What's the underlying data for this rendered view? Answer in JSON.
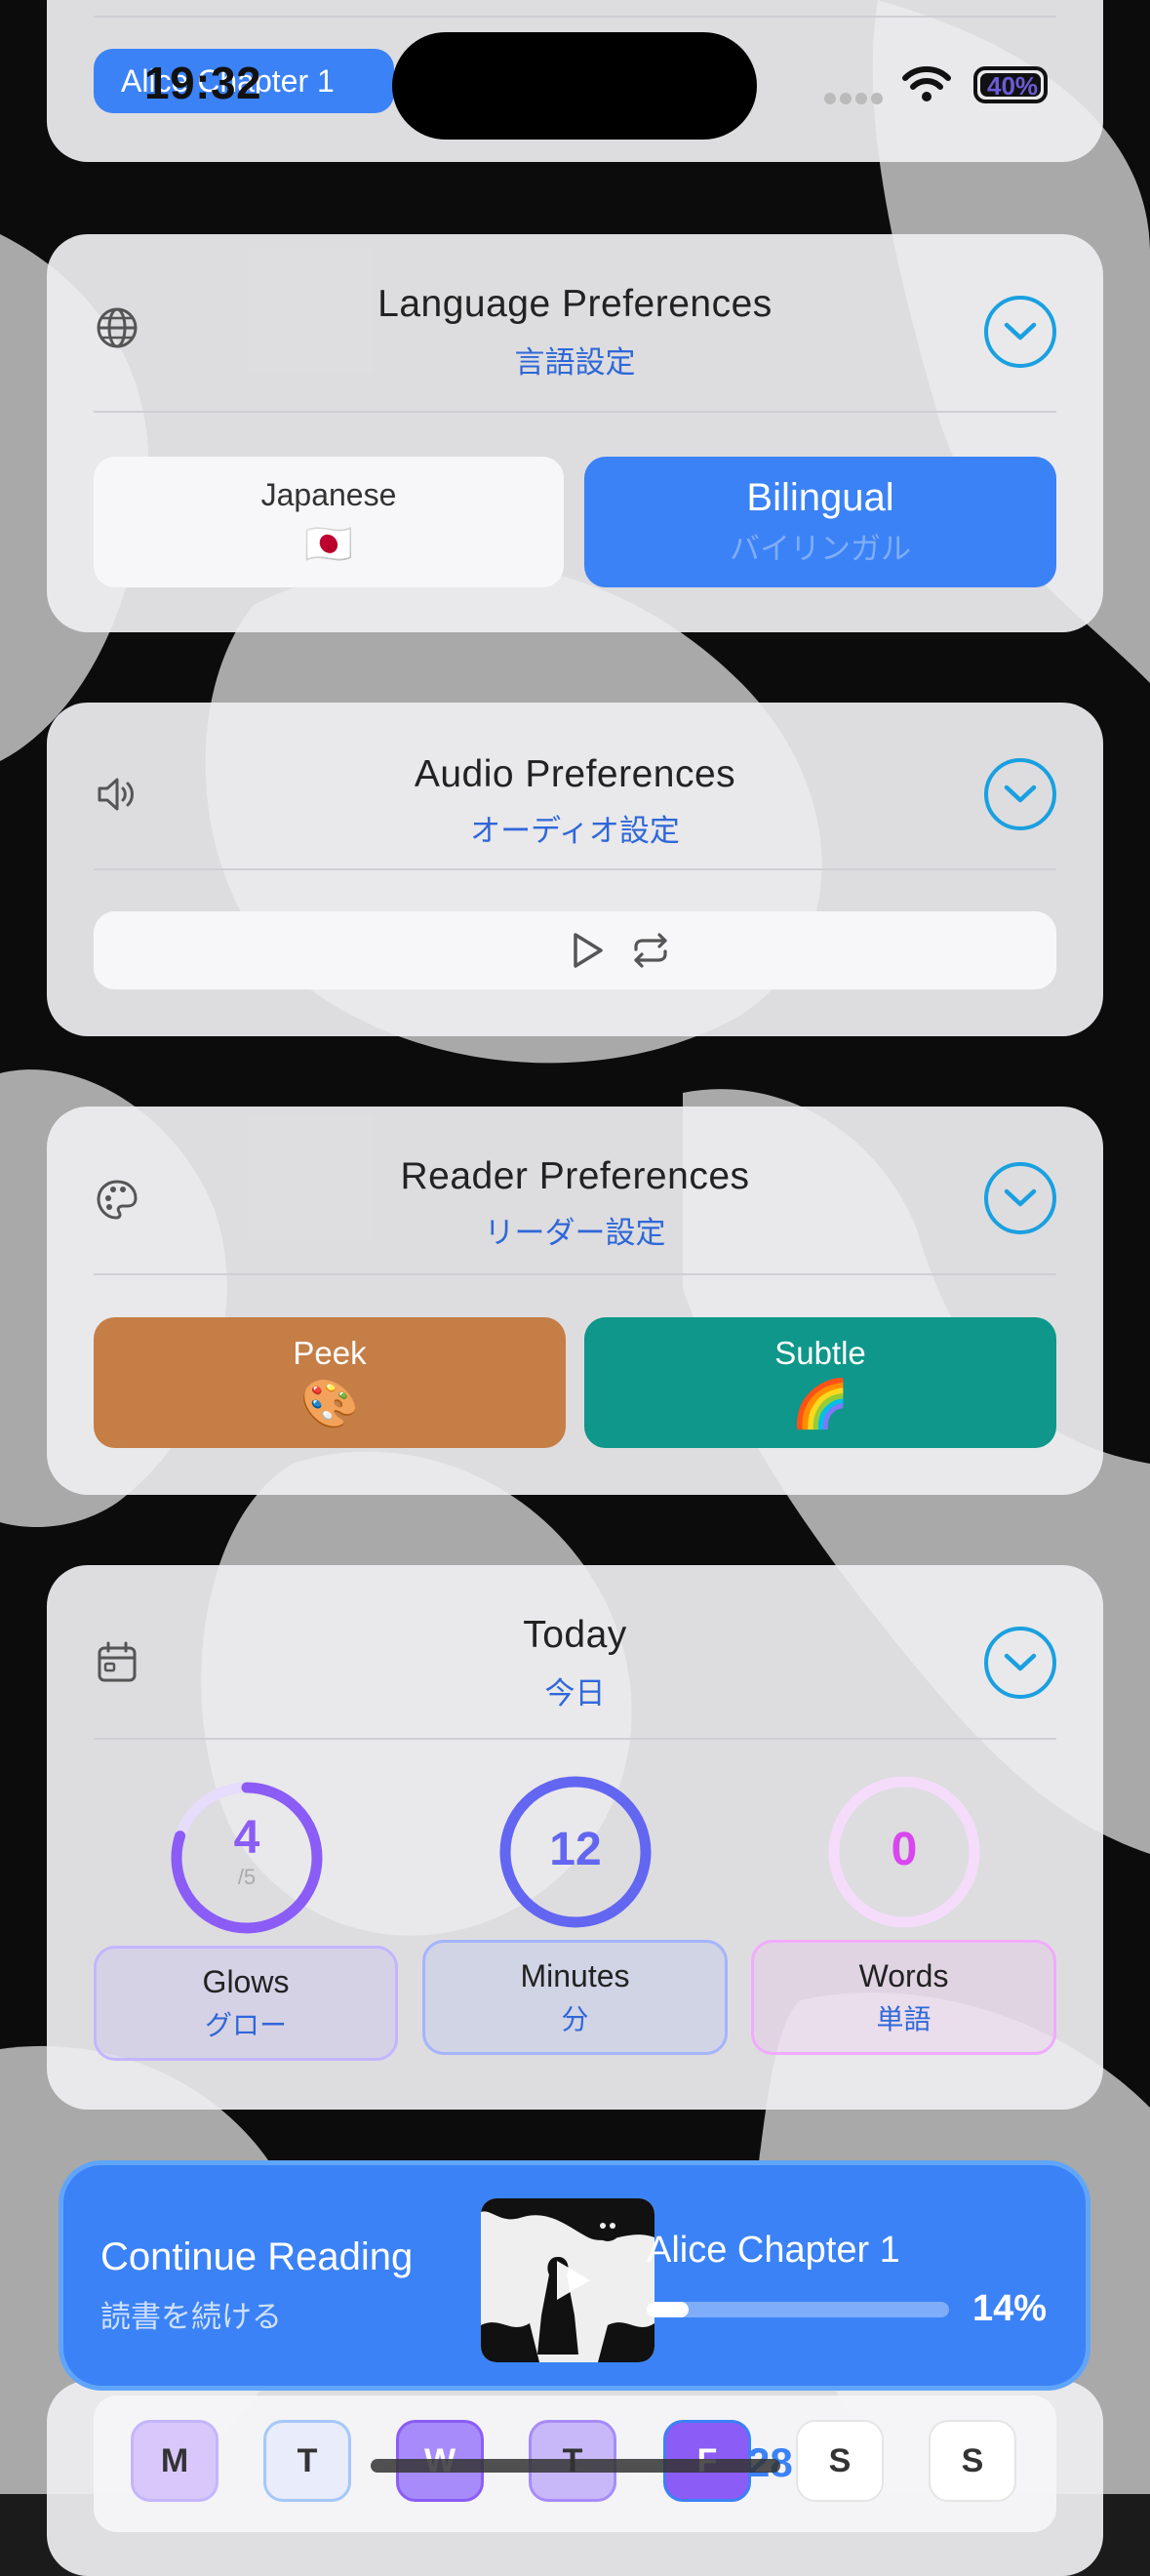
{
  "status_bar": {
    "time": "19:32",
    "pill_label": "Alice Chapter 1",
    "battery": "40%"
  },
  "language": {
    "title": "Language Preferences",
    "subtitle": "言語設定",
    "option_left": {
      "label": "Japanese",
      "emoji": "🇯🇵"
    },
    "option_right": {
      "label": "Bilingual",
      "sub": "バイリンガル"
    }
  },
  "audio": {
    "title": "Audio Preferences",
    "subtitle": "オーディオ設定"
  },
  "reader": {
    "title": "Reader Preferences",
    "subtitle": "リーダー設定",
    "option_left": {
      "label": "Peek",
      "emoji": "🎨"
    },
    "option_right": {
      "label": "Subtle",
      "emoji": "🌈"
    }
  },
  "today": {
    "title": "Today",
    "subtitle": "今日",
    "glows": {
      "value": "4",
      "goal": "/5",
      "progress": 0.8,
      "label": "Glows",
      "sub": "グロー"
    },
    "minutes": {
      "value": "12",
      "progress": 1.0,
      "label": "Minutes",
      "sub": "分"
    },
    "words": {
      "value": "0",
      "progress": 0.0,
      "label": "Words",
      "sub": "単語"
    }
  },
  "continue": {
    "title": "Continue Reading",
    "subtitle": "読書を続ける",
    "book_title": "Alice Chapter 1",
    "percent": "14%",
    "progress": 0.14
  },
  "week": {
    "days": [
      "M",
      "T",
      "W",
      "T",
      "F",
      "S",
      "S"
    ],
    "streak": "28"
  },
  "colors": {
    "accent_blue": "#3b82f6",
    "peek": "#c57e46",
    "subtle": "#0e978a",
    "glow_purple": "#8b5cf6",
    "minutes_indigo": "#6366f1",
    "words_pink": "#d946ef"
  }
}
